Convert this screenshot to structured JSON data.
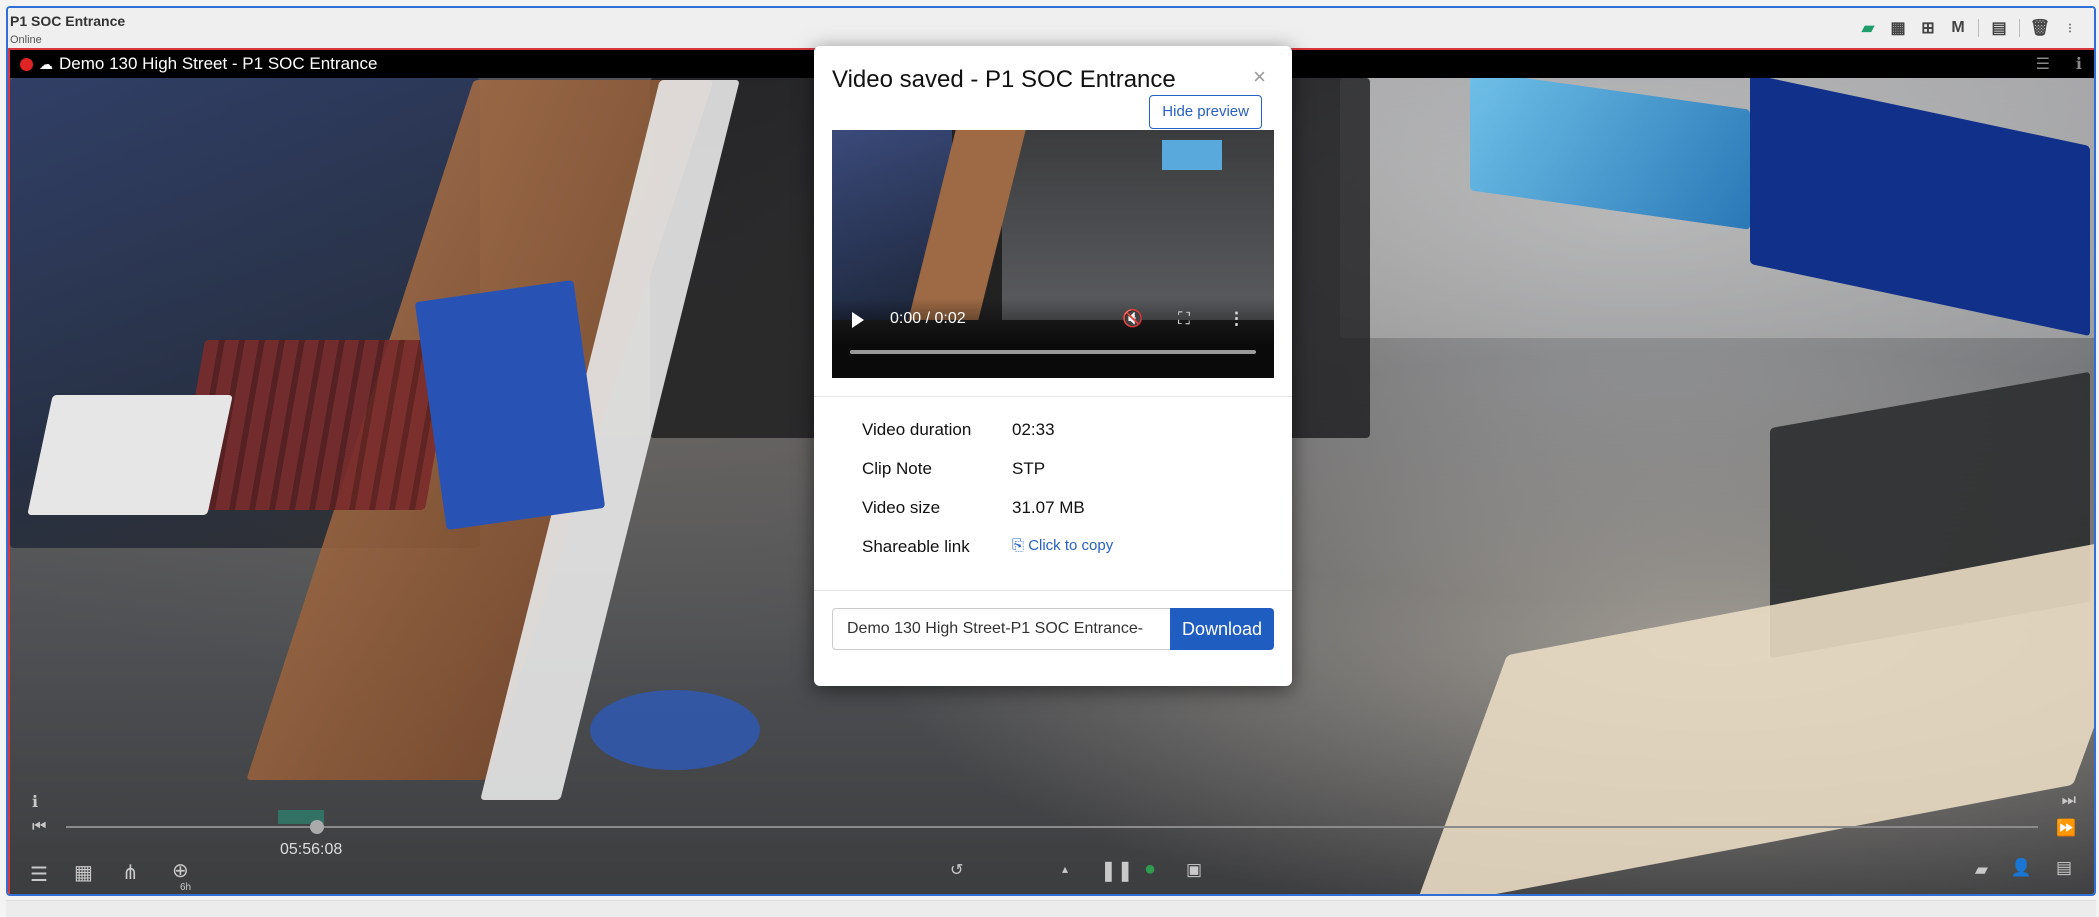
{
  "panel": {
    "title": "P1 SOC Entrance",
    "status": "Online",
    "tools": [
      "video-camera-icon",
      "calendar-icon",
      "layout-grid-icon",
      "M",
      "clipboard-icon",
      "trash-icon",
      "more-icon"
    ],
    "accent": "#2f6fd6"
  },
  "video": {
    "camera_label": "Demo 130 High Street - P1 SOC Entrance",
    "recording_color": "#e02424",
    "timeline_time": "05:56:08",
    "zoom_label": "6h"
  },
  "modal": {
    "title": "Video saved - P1 SOC Entrance",
    "close_label": "×",
    "hide_preview_label": "Hide preview",
    "player": {
      "time": "0:00 / 0:02"
    },
    "details": [
      {
        "label": "Video duration",
        "value": "02:33"
      },
      {
        "label": "Clip Note",
        "value": "STP"
      },
      {
        "label": "Video size",
        "value": "31.07 MB"
      },
      {
        "label": "Shareable link",
        "value": "Click to copy"
      }
    ],
    "filename_value": "Demo 130 High Street-P1 SOC Entrance-",
    "download_label": "Download",
    "download_color": "#1f5dc0"
  }
}
